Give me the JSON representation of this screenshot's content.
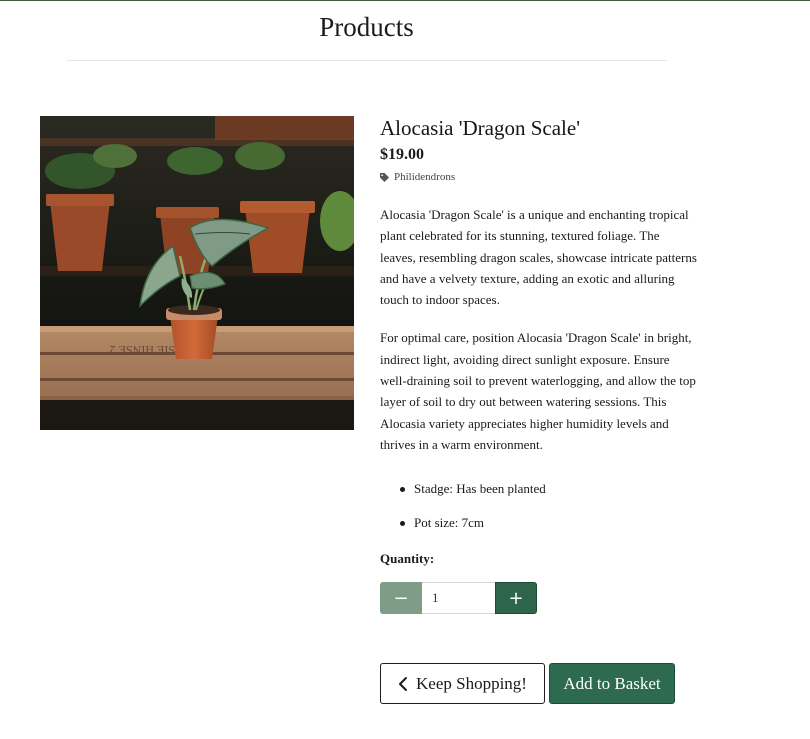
{
  "page": {
    "title": "Products"
  },
  "product": {
    "name": "Alocasia 'Dragon Scale'",
    "price": "$19.00",
    "category": "Philidendrons",
    "description": [
      "Alocasia 'Dragon Scale' is a unique and enchanting tropical plant celebrated for its stunning, textured foliage. The leaves, resembling dragon scales, showcase intricate patterns and have a velvety texture, adding an exotic and alluring touch to indoor spaces.",
      "For optimal care, position Alocasia 'Dragon Scale' in bright, indirect light, avoiding direct sunlight exposure. Ensure well-draining soil to prevent waterlogging, and allow the top layer of soil to dry out between watering sessions. This Alocasia variety appreciates higher humidity levels and thrives in a warm environment."
    ],
    "specs": [
      "Stadge: Has been planted",
      "Pot size: 7cm"
    ]
  },
  "quantity": {
    "label": "Quantity:",
    "value": "1",
    "minus_symbol": "−",
    "plus_symbol": "+"
  },
  "actions": {
    "keep_shopping": "Keep Shopping!",
    "add_to_basket": "Add to Basket"
  },
  "icons": {
    "category": "tag-icon",
    "back": "chevron-left-icon"
  },
  "colors": {
    "primary_green": "#2d6a4f",
    "muted_green": "#7e9d87",
    "top_border": "#3d5e3f"
  }
}
